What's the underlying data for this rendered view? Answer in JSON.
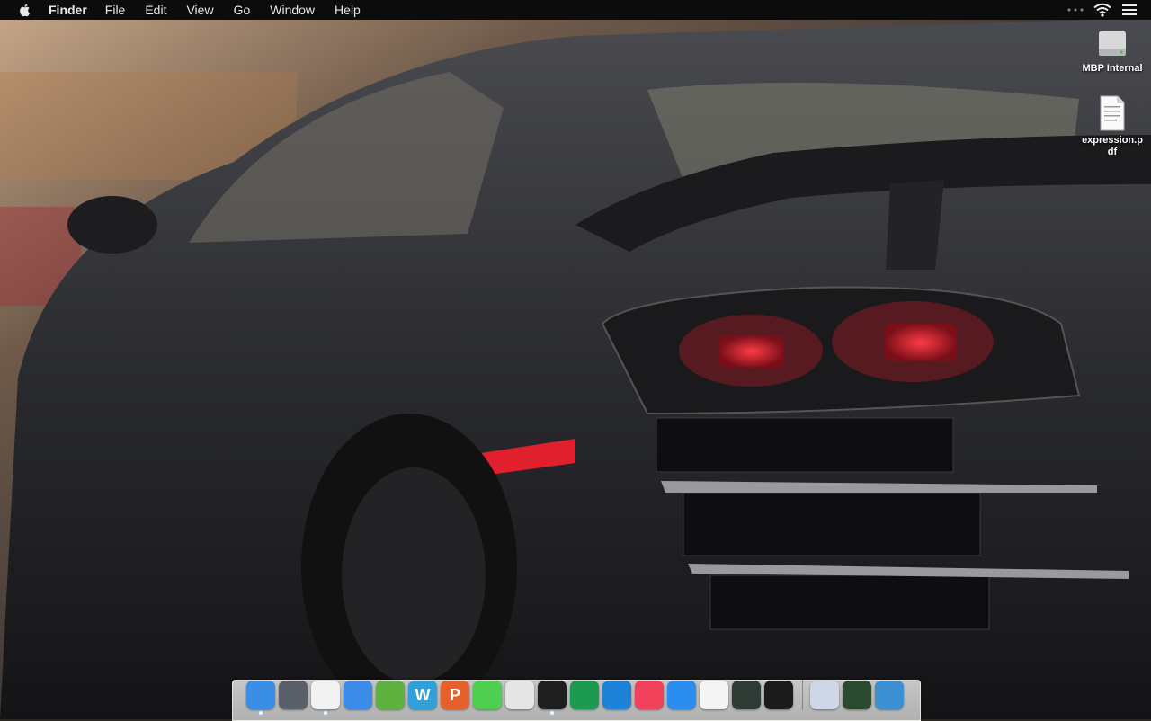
{
  "menubar": {
    "apple_icon": "apple-logo-icon",
    "app_name": "Finder",
    "items": [
      "File",
      "Edit",
      "View",
      "Go",
      "Window",
      "Help"
    ],
    "status_icons": [
      "more-dots-icon",
      "wifi-icon",
      "notification-list-icon"
    ]
  },
  "desktop": {
    "icons": [
      {
        "label": "MBP Internal",
        "icon": "hard-drive-icon"
      },
      {
        "label": "expression.pdf",
        "icon": "pdf-document-icon"
      }
    ]
  },
  "dock": {
    "apps": [
      {
        "name": "finder-icon",
        "color": "#3a8ee6",
        "running": true
      },
      {
        "name": "launchpad-icon",
        "color": "#5b5f6a",
        "running": false
      },
      {
        "name": "chrome-icon",
        "color": "#f2f2f2",
        "running": true
      },
      {
        "name": "mail-icon",
        "color": "#3d8be8",
        "running": false
      },
      {
        "name": "evernote-icon",
        "color": "#5fb23f",
        "running": false
      },
      {
        "name": "word-icon",
        "color": "#2fa0d8",
        "glyph": "W",
        "running": false
      },
      {
        "name": "powerpoint-icon",
        "color": "#e5612c",
        "glyph": "P",
        "running": false
      },
      {
        "name": "messages-icon",
        "color": "#4fcf4f",
        "running": false
      },
      {
        "name": "screenshot-camera-icon",
        "color": "#e6e6e6",
        "running": false
      },
      {
        "name": "spotify-icon",
        "color": "#1e1e1e",
        "running": true
      },
      {
        "name": "u-app-icon",
        "color": "#1c9a52",
        "running": false
      },
      {
        "name": "swirl-app-icon",
        "color": "#1e82d8",
        "running": false
      },
      {
        "name": "itunes-icon",
        "color": "#f0405a",
        "running": false
      },
      {
        "name": "app-store-icon",
        "color": "#2a8ef0",
        "running": false
      },
      {
        "name": "ring-app-icon",
        "color": "#f4f4f4",
        "running": false
      },
      {
        "name": "activity-monitor-icon",
        "color": "#2e3a34",
        "running": false
      },
      {
        "name": "terminal-icon",
        "color": "#1b1b1b",
        "running": false
      }
    ],
    "stack_items": [
      {
        "name": "downloads-stack-icon",
        "color": "#cfd6e6"
      },
      {
        "name": "document-stack-icon",
        "color": "#2b4a30"
      },
      {
        "name": "trash-icon",
        "color": "#3c8fd0"
      }
    ]
  }
}
